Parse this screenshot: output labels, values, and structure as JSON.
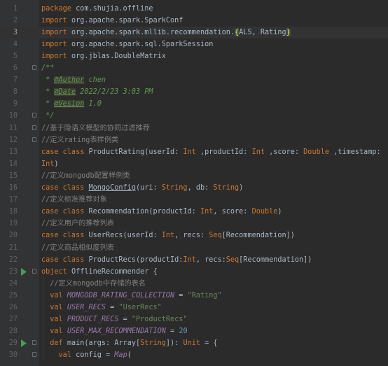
{
  "colors": {
    "background": "#2b2b2b",
    "gutter": "#313335",
    "keyword": "#cc7832",
    "string": "#6a8759",
    "number": "#6897bb",
    "comment": "#808080",
    "doc_comment": "#629755",
    "field": "#9876aa",
    "run_arrow": "#499c54"
  },
  "editor": {
    "current_line": 3,
    "lines": [
      {
        "n": "1",
        "tokens": [
          [
            "k",
            "package"
          ],
          [
            "p",
            " com.shujia.offline"
          ]
        ]
      },
      {
        "n": "2",
        "tokens": [
          [
            "k",
            "import"
          ],
          [
            "p",
            " org.apache.spark.SparkConf"
          ]
        ]
      },
      {
        "n": "3",
        "tokens": [
          [
            "k",
            "import"
          ],
          [
            "p",
            " org.apache.spark.mllib.recommendation."
          ],
          [
            "br",
            "{"
          ],
          [
            "p",
            "ALS, Rating"
          ],
          [
            "br",
            "}"
          ]
        ]
      },
      {
        "n": "4",
        "tokens": [
          [
            "k",
            "import"
          ],
          [
            "p",
            " org.apache.spark.sql.SparkSession"
          ]
        ]
      },
      {
        "n": "5",
        "tokens": [
          [
            "k",
            "import"
          ],
          [
            "p",
            " org.jblas.DoubleMatrix"
          ]
        ]
      },
      {
        "n": "6",
        "tokens": [
          [
            "dc",
            "/**"
          ]
        ],
        "fold": true
      },
      {
        "n": "7",
        "tokens": [
          [
            "dc",
            " * "
          ],
          [
            "dt",
            "@Author"
          ],
          [
            "dc",
            " chen"
          ]
        ]
      },
      {
        "n": "8",
        "tokens": [
          [
            "dc",
            " * "
          ],
          [
            "dt",
            "@Date"
          ],
          [
            "dc",
            " 2022/2/23 3:03 PM"
          ]
        ]
      },
      {
        "n": "9",
        "tokens": [
          [
            "dc",
            " * "
          ],
          [
            "dt",
            "@Vesion"
          ],
          [
            "dc",
            " 1.0"
          ]
        ]
      },
      {
        "n": "10",
        "tokens": [
          [
            "dc",
            " */"
          ]
        ],
        "fold": true
      },
      {
        "n": "11",
        "tokens": [
          [
            "c",
            "//基于隐语义模型的协同过滤推荐"
          ]
        ],
        "fold": true
      },
      {
        "n": "12",
        "tokens": [
          [
            "c",
            "//定义rating表样例类"
          ]
        ],
        "fold": true
      },
      {
        "n": "13",
        "tokens": [
          [
            "k",
            "case class"
          ],
          [
            "p",
            " ProductRating(userId: "
          ],
          [
            "t",
            "Int"
          ],
          [
            "p",
            " ,productId: "
          ],
          [
            "t",
            "Int"
          ],
          [
            "p",
            " ,score: "
          ],
          [
            "t",
            "Double"
          ],
          [
            "p",
            " ,timestamp:"
          ]
        ]
      },
      {
        "n": "14",
        "tokens": [
          [
            "t",
            "Int"
          ],
          [
            "p",
            ")"
          ]
        ]
      },
      {
        "n": "15",
        "tokens": [
          [
            "c",
            "//定义mongodb配置样例类"
          ]
        ]
      },
      {
        "n": "16",
        "tokens": [
          [
            "k",
            "case class"
          ],
          [
            "p",
            " "
          ],
          [
            "ul",
            "MongoConfig"
          ],
          [
            "p",
            "(uri: "
          ],
          [
            "t",
            "String"
          ],
          [
            "p",
            ", db: "
          ],
          [
            "t",
            "String"
          ],
          [
            "p",
            ")"
          ]
        ]
      },
      {
        "n": "17",
        "tokens": [
          [
            "c",
            "//定义标准推荐对象"
          ]
        ]
      },
      {
        "n": "18",
        "tokens": [
          [
            "k",
            "case class"
          ],
          [
            "p",
            " Recommendation(productId: "
          ],
          [
            "t",
            "Int"
          ],
          [
            "p",
            ", score: "
          ],
          [
            "t",
            "Double"
          ],
          [
            "p",
            ")"
          ]
        ]
      },
      {
        "n": "19",
        "tokens": [
          [
            "c",
            "//定义用户的推荐列表"
          ]
        ]
      },
      {
        "n": "20",
        "tokens": [
          [
            "k",
            "case class"
          ],
          [
            "p",
            " UserRecs(userId: "
          ],
          [
            "t",
            "Int"
          ],
          [
            "p",
            ", recs: "
          ],
          [
            "t",
            "Seq"
          ],
          [
            "p",
            "[Recommendation])"
          ]
        ]
      },
      {
        "n": "21",
        "tokens": [
          [
            "c",
            "//定义商品相似度列表"
          ]
        ]
      },
      {
        "n": "22",
        "tokens": [
          [
            "k",
            "case class"
          ],
          [
            "p",
            " ProductRecs(productId:"
          ],
          [
            "t",
            "Int"
          ],
          [
            "p",
            ", recs:"
          ],
          [
            "t",
            "Seq"
          ],
          [
            "p",
            "[Recommendation])"
          ]
        ]
      },
      {
        "n": "23",
        "tokens": [
          [
            "k",
            "object"
          ],
          [
            "p",
            " OfflineRecommender {"
          ]
        ],
        "run": true,
        "fold": true
      },
      {
        "n": "24",
        "tokens": [
          [
            "p",
            "  "
          ],
          [
            "c",
            "//定义mongodb中存储的表名"
          ]
        ]
      },
      {
        "n": "25",
        "tokens": [
          [
            "p",
            "  "
          ],
          [
            "k",
            "val"
          ],
          [
            "p",
            " "
          ],
          [
            "it",
            "MONGODB_RATING_COLLECTION"
          ],
          [
            "p",
            " = "
          ],
          [
            "s",
            "\"Rating\""
          ]
        ]
      },
      {
        "n": "26",
        "tokens": [
          [
            "p",
            "  "
          ],
          [
            "k",
            "val"
          ],
          [
            "p",
            " "
          ],
          [
            "it",
            "USER_RECS"
          ],
          [
            "p",
            " = "
          ],
          [
            "s",
            "\"UserRecs\""
          ]
        ]
      },
      {
        "n": "27",
        "tokens": [
          [
            "p",
            "  "
          ],
          [
            "k",
            "val"
          ],
          [
            "p",
            " "
          ],
          [
            "it",
            "PRODUCT_RECS"
          ],
          [
            "p",
            " = "
          ],
          [
            "s",
            "\"ProductRecs\""
          ]
        ]
      },
      {
        "n": "28",
        "tokens": [
          [
            "p",
            "  "
          ],
          [
            "k",
            "val"
          ],
          [
            "p",
            " "
          ],
          [
            "it",
            "USER_MAX_RECOMMENDATION"
          ],
          [
            "p",
            " = "
          ],
          [
            "n",
            "20"
          ]
        ]
      },
      {
        "n": "29",
        "tokens": [
          [
            "p",
            "  "
          ],
          [
            "k",
            "def"
          ],
          [
            "p",
            " main(args: Array["
          ],
          [
            "t",
            "String"
          ],
          [
            "p",
            "]): "
          ],
          [
            "t",
            "Unit"
          ],
          [
            "p",
            " = {"
          ]
        ],
        "run": true,
        "fold": true
      },
      {
        "n": "30",
        "tokens": [
          [
            "p",
            "    "
          ],
          [
            "k",
            "val"
          ],
          [
            "p",
            " config = "
          ],
          [
            "it",
            "Map"
          ],
          [
            "p",
            "("
          ]
        ],
        "fold": true
      }
    ]
  }
}
